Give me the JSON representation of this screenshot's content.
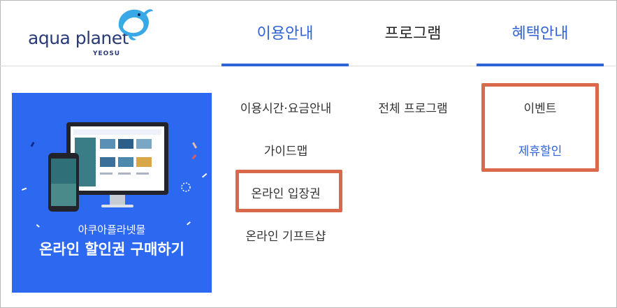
{
  "logo": {
    "text": "aqua planet",
    "sub": "YEOSU"
  },
  "nav": [
    {
      "label": "이용안내",
      "color": "#2f63d8"
    },
    {
      "label": "프로그램",
      "color": "#222222"
    },
    {
      "label": "혜택안내",
      "color": "#2f63d8"
    }
  ],
  "banner": {
    "line1": "아쿠아플라넷몰",
    "line2": "온라인 할인권 구매하기",
    "bg": "#2d68f0"
  },
  "submenu": {
    "col1": [
      "이용시간·요금안내",
      "가이드맵",
      "온라인 입장권",
      "온라인 기프트샵"
    ],
    "col2": [
      "전체 프로그램"
    ],
    "col3": [
      "이벤트",
      "제휴할인"
    ]
  },
  "colors": {
    "accent": "#2f63d8",
    "highlight": "#d9694a",
    "text": "#333333"
  },
  "icons": [
    "whale-logo-icon",
    "monitor-icon",
    "smartphone-icon"
  ]
}
